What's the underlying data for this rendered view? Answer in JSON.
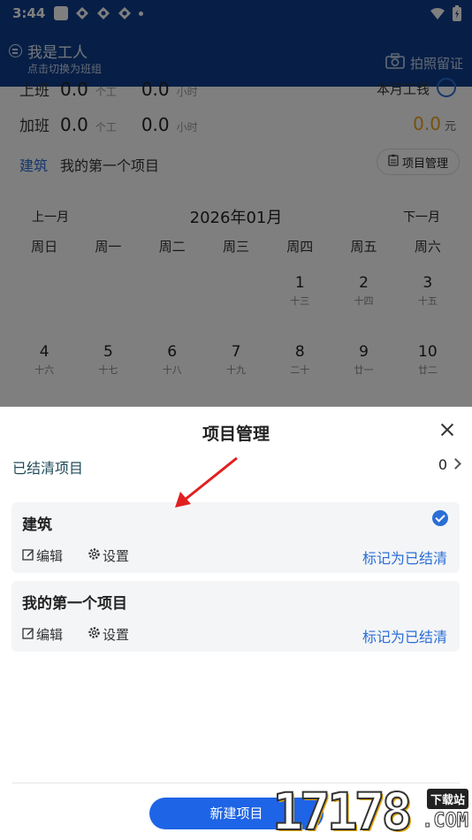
{
  "status_bar": {
    "time": "3:44"
  },
  "header": {
    "role_title": "我是工人",
    "role_subtitle": "点击切换为班组",
    "photo_label": "拍照留证"
  },
  "summary": {
    "work_label": "上班",
    "work_days": "0.0",
    "work_unit": "个工",
    "work_hours": "0.0",
    "work_hours_unit": "小时",
    "month_wage_label": "本月工钱",
    "overtime_label": "加班",
    "overtime_days": "0.0",
    "overtime_unit": "个工",
    "overtime_hours": "0.0",
    "overtime_hours_unit": "小时",
    "amount": "0.0",
    "amount_unit": "元"
  },
  "project_bar": {
    "current": "建筑",
    "name": "我的第一个项目",
    "manage_label": "项目管理"
  },
  "calendar": {
    "prev": "上一月",
    "next": "下一月",
    "title": "2026年01月",
    "weekdays": [
      "周日",
      "周一",
      "周二",
      "周三",
      "周四",
      "周五",
      "周六"
    ],
    "row1": [
      {
        "d": "1",
        "l": "十三"
      },
      {
        "d": "2",
        "l": "十四"
      },
      {
        "d": "3",
        "l": "十五"
      }
    ],
    "row2": [
      {
        "d": "4",
        "l": "十六"
      },
      {
        "d": "5",
        "l": "十七"
      },
      {
        "d": "6",
        "l": "十八"
      },
      {
        "d": "7",
        "l": "十九"
      },
      {
        "d": "8",
        "l": "二十"
      },
      {
        "d": "9",
        "l": "廿一"
      },
      {
        "d": "10",
        "l": "廿二"
      }
    ]
  },
  "sheet": {
    "title": "项目管理",
    "settled_label": "已结清项目",
    "settled_count": "0",
    "projects": [
      {
        "name": "建筑",
        "edit": "编辑",
        "settings": "设置",
        "mark": "标记为已结清",
        "selected": true
      },
      {
        "name": "我的第一个项目",
        "edit": "编辑",
        "settings": "设置",
        "mark": "标记为已结清",
        "selected": false
      }
    ],
    "new_button": "新建项目"
  },
  "watermark": {
    "number": "17178",
    "tag": "下载站",
    "domain": ".COM"
  },
  "colors": {
    "header": "#0f3f8c",
    "accent": "#2a6ed6",
    "button": "#1e64e6",
    "amount": "#f0a020"
  }
}
